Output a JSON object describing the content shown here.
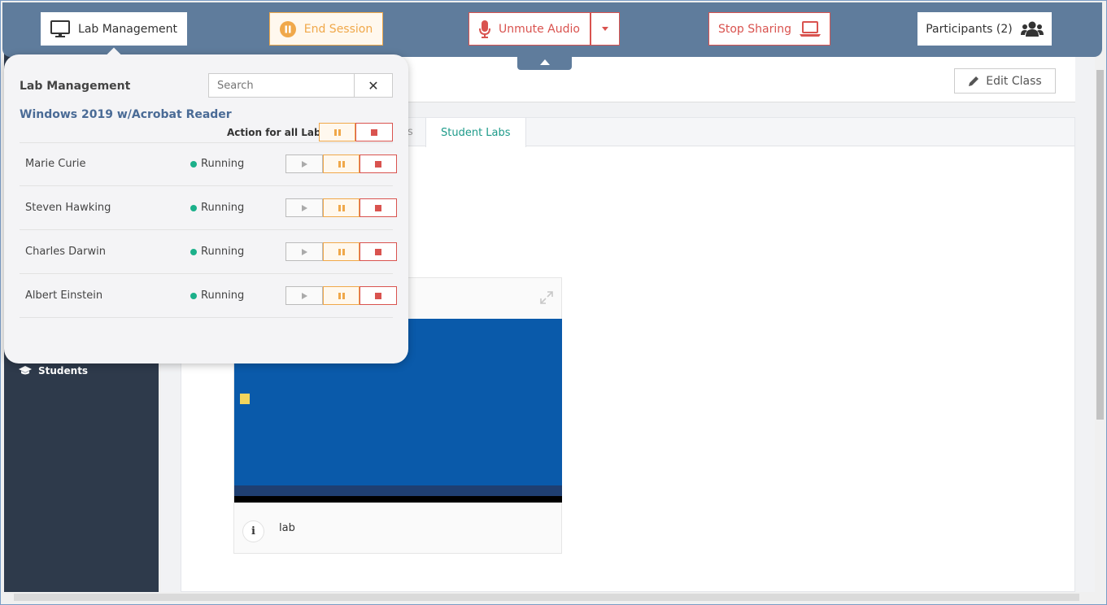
{
  "toolbar": {
    "lab_management": "Lab Management",
    "end_session": "End Session",
    "unmute_audio": "Unmute Audio",
    "stop_sharing": "Stop Sharing",
    "participants": "Participants (2)"
  },
  "header": {
    "title_fragment": "er",
    "edit_class": "Edit Class"
  },
  "tabs": {
    "partial_label": "s",
    "active_label": "Student Labs"
  },
  "sidebar": {
    "students": "Students"
  },
  "lab_card": {
    "name": "lab",
    "info": "i"
  },
  "popup": {
    "title": "Lab Management",
    "search_placeholder": "Search",
    "close": "✕",
    "lab_template": "Windows 2019 w/Acrobat Reader",
    "action_all_label": "Action for all Labs:",
    "students": [
      {
        "name": "Marie Curie",
        "status": "Running"
      },
      {
        "name": "Steven Hawking",
        "status": "Running"
      },
      {
        "name": "Charles Darwin",
        "status": "Running"
      },
      {
        "name": "Albert Einstein",
        "status": "Running"
      }
    ]
  },
  "colors": {
    "toolbar_bg": "#5f7c9c",
    "sidebar_bg": "#2e3a4b",
    "accent_teal": "#1e9b8a",
    "warning_orange": "#f0a84a",
    "danger_red": "#d9534f",
    "lab_template_blue": "#4a6b96",
    "running_green": "#1bb08a"
  },
  "icons": [
    "monitor-icon",
    "pause-circle-icon",
    "microphone-icon",
    "caret-down-icon",
    "laptop-icon",
    "users-icon",
    "caret-up-icon",
    "pencil-icon",
    "expand-icon",
    "graduation-cap-icon",
    "close-icon",
    "play-icon",
    "pause-icon",
    "stop-icon",
    "info-icon"
  ]
}
